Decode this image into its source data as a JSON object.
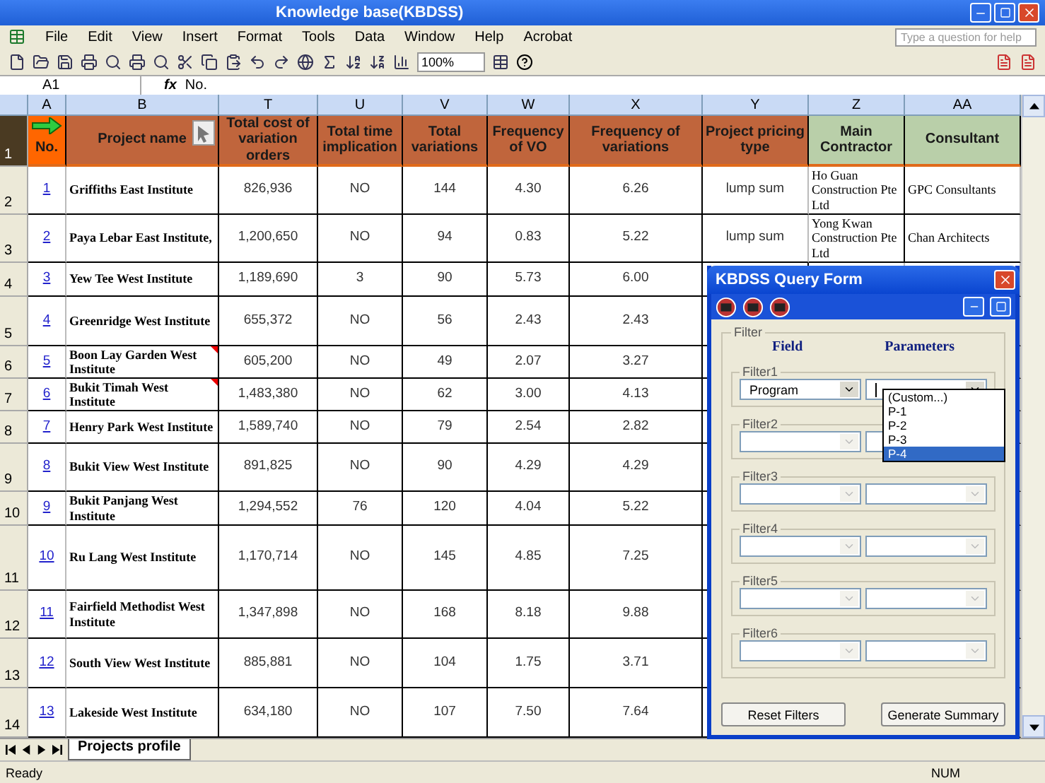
{
  "window": {
    "title": "Knowledge base(KBDSS)"
  },
  "menu": [
    "File",
    "Edit",
    "View",
    "Insert",
    "Format",
    "Tools",
    "Data",
    "Window",
    "Help",
    "Acrobat"
  ],
  "help_box": {
    "placeholder": "Type a question for help"
  },
  "toolbar": {
    "zoom": "100%"
  },
  "formula_bar": {
    "name_box": "A1",
    "fx": "fx",
    "formula": "No."
  },
  "columns": [
    {
      "letter": "A",
      "heading": "No.",
      "kind": "key"
    },
    {
      "letter": "B",
      "heading": "Project name",
      "kind": "main"
    },
    {
      "letter": "T",
      "heading": "Total cost of variation orders",
      "kind": "main"
    },
    {
      "letter": "U",
      "heading": "Total time implication",
      "kind": "main"
    },
    {
      "letter": "V",
      "heading": "Total variations",
      "kind": "main"
    },
    {
      "letter": "W",
      "heading": "Frequency of VO",
      "kind": "main"
    },
    {
      "letter": "X",
      "heading": "Frequency of variations",
      "kind": "main"
    },
    {
      "letter": "Y",
      "heading": "Project pricing type",
      "kind": "main"
    },
    {
      "letter": "Z",
      "heading": "Main Contractor",
      "kind": "party"
    },
    {
      "letter": "AA",
      "heading": "Consultant",
      "kind": "party"
    }
  ],
  "header_row": "1",
  "rows": [
    {
      "row": "2",
      "no": "1",
      "name": "Griffiths East Institute",
      "comment": false,
      "cells": [
        "826,936",
        "NO",
        "144",
        "4.30",
        "6.26",
        "lump sum"
      ],
      "contractor": "Ho Guan Construction Pte Ltd",
      "consultant": "GPC Consultants"
    },
    {
      "row": "3",
      "no": "2",
      "name": "Paya Lebar East Institute,",
      "comment": false,
      "cells": [
        "1,200,650",
        "NO",
        "94",
        "0.83",
        "5.22",
        "lump sum"
      ],
      "contractor": "Yong Kwan Construction Pte Ltd",
      "consultant": "Chan Architects"
    },
    {
      "row": "4",
      "no": "3",
      "name": "Yew Tee West Institute",
      "comment": false,
      "cells": [
        "1,189,690",
        "3",
        "90",
        "5.73",
        "6.00"
      ]
    },
    {
      "row": "5",
      "no": "4",
      "name": "Greenridge West Institute",
      "comment": false,
      "cells": [
        "655,372",
        "NO",
        "56",
        "2.43",
        "2.43"
      ]
    },
    {
      "row": "6",
      "no": "5",
      "name": "Boon Lay Garden West Institute",
      "comment": true,
      "cells": [
        "605,200",
        "NO",
        "49",
        "2.07",
        "3.27"
      ]
    },
    {
      "row": "7",
      "no": "6",
      "name": "Bukit Timah West Institute",
      "comment": true,
      "cells": [
        "1,483,380",
        "NO",
        "62",
        "3.00",
        "4.13"
      ]
    },
    {
      "row": "8",
      "no": "7",
      "name": "Henry Park West Institute",
      "comment": false,
      "cells": [
        "1,589,740",
        "NO",
        "79",
        "2.54",
        "2.82"
      ]
    },
    {
      "row": "9",
      "no": "8",
      "name": "Bukit View West Institute",
      "comment": false,
      "cells": [
        "891,825",
        "NO",
        "90",
        "4.29",
        "4.29"
      ]
    },
    {
      "row": "10",
      "no": "9",
      "name": "Bukit Panjang West Institute",
      "comment": false,
      "cells": [
        "1,294,552",
        "76",
        "120",
        "4.04",
        "5.22"
      ]
    },
    {
      "row": "11",
      "no": "10",
      "name": "Ru Lang West Institute",
      "comment": false,
      "cells": [
        "1,170,714",
        "NO",
        "145",
        "4.85",
        "7.25"
      ]
    },
    {
      "row": "12",
      "no": "11",
      "name": "Fairfield Methodist West Institute",
      "comment": false,
      "cells": [
        "1,347,898",
        "NO",
        "168",
        "8.18",
        "9.88"
      ]
    },
    {
      "row": "13",
      "no": "12",
      "name": "South View West Institute",
      "comment": false,
      "cells": [
        "885,881",
        "NO",
        "104",
        "1.75",
        "3.71"
      ]
    },
    {
      "row": "14",
      "no": "13",
      "name": "Lakeside West Institute",
      "comment": false,
      "cells": [
        "634,180",
        "NO",
        "107",
        "7.50",
        "7.64"
      ]
    }
  ],
  "sheet_tabs": [
    {
      "label": "Projects profile",
      "selected": true
    }
  ],
  "status_bar": {
    "left": "Ready",
    "right": "NUM"
  },
  "dialog": {
    "title": "KBDSS Query Form",
    "group": "Filter",
    "field_heading": "Field",
    "parameter_heading": "Parameters",
    "filters": [
      {
        "label": "Filter1",
        "field": "Program",
        "disabled": false,
        "open": true
      },
      {
        "label": "Filter2",
        "disabled": true,
        "open": false
      },
      {
        "label": "Filter3",
        "disabled": true,
        "open": false
      },
      {
        "label": "Filter4",
        "disabled": true,
        "open": false
      },
      {
        "label": "Filter5",
        "disabled": true,
        "open": false
      },
      {
        "label": "Filter6",
        "disabled": true,
        "open": false
      }
    ],
    "options": [
      {
        "label": "(Custom...)",
        "selected": false
      },
      {
        "label": "P-1",
        "selected": false
      },
      {
        "label": "P-2",
        "selected": false
      },
      {
        "label": "P-3",
        "selected": false
      },
      {
        "label": "P-4",
        "selected": true
      }
    ],
    "buttons": [
      "Reset Filters",
      "Generate Summary"
    ]
  }
}
